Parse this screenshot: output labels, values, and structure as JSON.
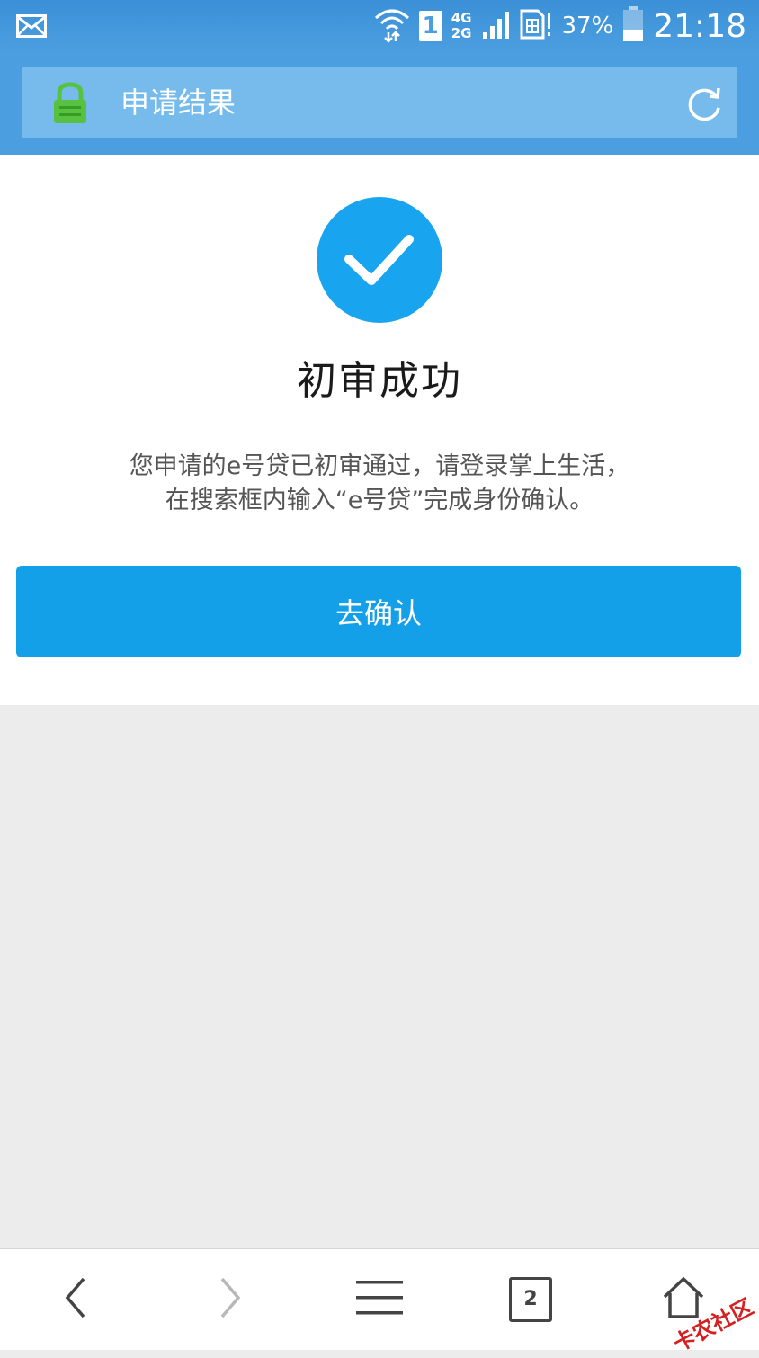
{
  "status_bar": {
    "network_top": "4G",
    "network_bottom": "2G",
    "sim_label": "1",
    "battery_percent": "37%",
    "battery_level": 0.37,
    "time": "21:18"
  },
  "address_bar": {
    "title": "申请结果",
    "lock_icon": "lock-icon",
    "refresh_icon": "refresh-icon",
    "secure_color": "#57c23f"
  },
  "result": {
    "icon": "check-circle-icon",
    "icon_color": "#18a4ee",
    "title": "初审成功",
    "description_line1": "您申请的e号贷已初审通过，请登录掌上生活，",
    "description_line2": "在搜索框内输入“e号贷”完成身份确认。",
    "button_label": "去确认",
    "button_color": "#149fe9"
  },
  "bottom_nav": {
    "back_icon": "chevron-left-icon",
    "forward_icon": "chevron-right-icon",
    "menu_icon": "menu-icon",
    "tab_count": "2",
    "home_icon": "home-icon",
    "watermark": "卡农社区"
  }
}
